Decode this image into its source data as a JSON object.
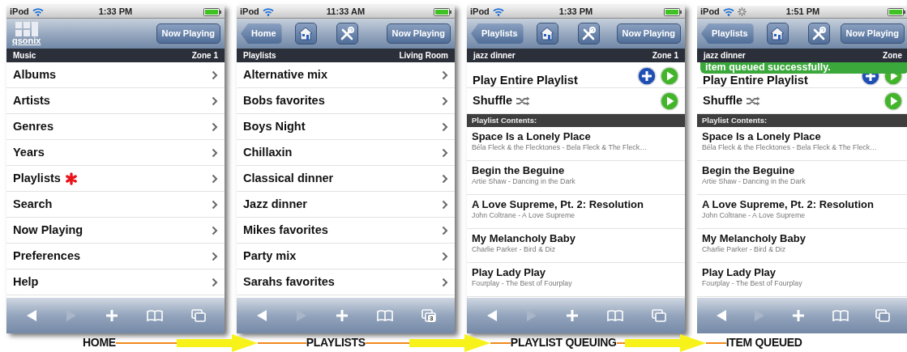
{
  "screens": [
    {
      "kind": "menu",
      "status": {
        "carrier": "iPod",
        "time": "1:33 PM",
        "activity": false
      },
      "nav": {
        "logo": "qsonix",
        "now_playing": "Now Playing"
      },
      "subheader": {
        "left": "Music",
        "right": "Zone 1"
      },
      "items": [
        {
          "label": "Albums",
          "starred": false
        },
        {
          "label": "Artists",
          "starred": false
        },
        {
          "label": "Genres",
          "starred": false
        },
        {
          "label": "Years",
          "starred": false
        },
        {
          "label": "Playlists",
          "starred": true
        },
        {
          "label": "Search",
          "starred": false
        },
        {
          "label": "Now Playing",
          "starred": false
        },
        {
          "label": "Preferences",
          "starred": false
        },
        {
          "label": "Help",
          "starred": false
        }
      ]
    },
    {
      "kind": "menu",
      "status": {
        "carrier": "iPod",
        "time": "11:33 AM",
        "activity": false
      },
      "nav": {
        "back": "Home",
        "now_playing": "Now Playing"
      },
      "subheader": {
        "left": "Playlists",
        "right": "Living Room"
      },
      "items": [
        {
          "label": "Alternative mix",
          "starred": false
        },
        {
          "label": "Bobs favorites",
          "starred": false
        },
        {
          "label": "Boys Night",
          "starred": false
        },
        {
          "label": "Chillaxin",
          "starred": false
        },
        {
          "label": "Classical dinner",
          "starred": false
        },
        {
          "label": "Jazz dinner",
          "starred": false
        },
        {
          "label": "Mikes favorites",
          "starred": false
        },
        {
          "label": "Party mix",
          "starred": false
        },
        {
          "label": "Sarahs favorites",
          "starred": false
        }
      ],
      "toolbar": {
        "page_count": "3"
      }
    },
    {
      "kind": "playlist",
      "status": {
        "carrier": "iPod",
        "time": "1:33 PM",
        "activity": false
      },
      "nav": {
        "back": "Playlists",
        "now_playing": "Now Playing"
      },
      "subheader": {
        "left": "jazz dinner",
        "right": "Zone 1"
      },
      "actions": [
        {
          "kind": "play_all",
          "label": "Play Entire Playlist"
        },
        {
          "kind": "shuffle",
          "label": "Shuffle"
        }
      ],
      "section": "Playlist Contents:",
      "songs": [
        {
          "title": "Space Is a Lonely Place",
          "subtitle": "Béla Fleck & the Flecktones - Bela Fleck & The Fleck…"
        },
        {
          "title": "Begin the Beguine",
          "subtitle": "Artie Shaw - Dancing in the Dark"
        },
        {
          "title": "A Love Supreme, Pt. 2: Resolution",
          "subtitle": "John Coltrane - A Love Supreme"
        },
        {
          "title": "My Melancholy Baby",
          "subtitle": "Charlie Parker - Bird & Diz"
        },
        {
          "title": "Play Lady Play",
          "subtitle": "Fourplay - The Best of Fourplay"
        }
      ]
    },
    {
      "kind": "playlist",
      "status": {
        "carrier": "iPod",
        "time": "1:51 PM",
        "activity": true
      },
      "nav": {
        "back": "Playlists",
        "now_playing": "Now Playing"
      },
      "subheader": {
        "left": "jazz dinner",
        "right": "Zone"
      },
      "toast": "item queued successfully.",
      "actions": [
        {
          "kind": "play_all",
          "label": "Play Entire Playlist"
        },
        {
          "kind": "shuffle",
          "label": "Shuffle"
        }
      ],
      "section": "Playlist Contents:",
      "songs": [
        {
          "title": "Space Is a Lonely Place",
          "subtitle": "Béla Fleck & the Flecktones - Bela Fleck & The Fleck…"
        },
        {
          "title": "Begin the Beguine",
          "subtitle": "Artie Shaw - Dancing in the Dark"
        },
        {
          "title": "A Love Supreme, Pt. 2: Resolution",
          "subtitle": "John Coltrane - A Love Supreme"
        },
        {
          "title": "My Melancholy Baby",
          "subtitle": "Charlie Parker - Bird & Diz"
        },
        {
          "title": "Play Lady Play",
          "subtitle": "Fourplay - The Best of Fourplay"
        }
      ]
    }
  ],
  "captions": [
    "HOME",
    "PLAYLISTS",
    "PLAYLIST QUEUING",
    "ITEM QUEUED"
  ]
}
